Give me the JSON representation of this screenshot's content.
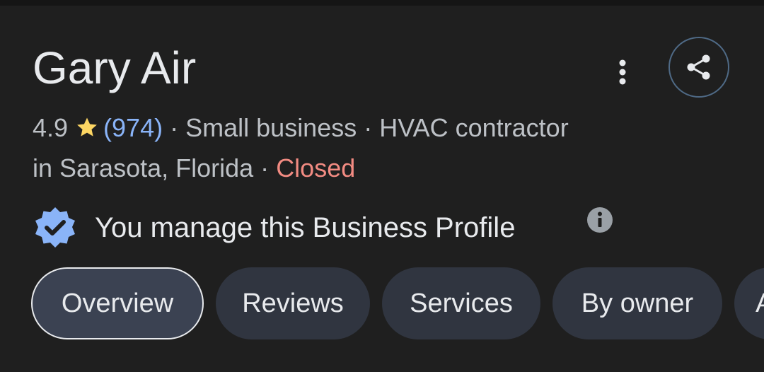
{
  "business": {
    "name": "Gary Air",
    "rating": "4.9",
    "review_count": "(974)",
    "separator": "·",
    "category_1": "Small business",
    "category_2": "HVAC contractor",
    "location": "in Sarasota, Florida",
    "status": "Closed"
  },
  "profile": {
    "manage_text": "You manage this Business Profile"
  },
  "tabs": [
    {
      "label": "Overview",
      "active": true
    },
    {
      "label": "Reviews",
      "active": false
    },
    {
      "label": "Services",
      "active": false
    },
    {
      "label": "By owner",
      "active": false
    },
    {
      "label": "A",
      "active": false
    }
  ],
  "colors": {
    "background": "#1f1f1f",
    "primary_text": "#e8eaed",
    "secondary_text": "#bdc1c6",
    "link_blue": "#8ab4f8",
    "closed_red": "#f28b82",
    "star_yellow": "#fdd663",
    "verified_blue": "#8ab4f8",
    "chip_bg": "#303540"
  },
  "icons": {
    "star": "star-icon",
    "more": "more-vert-icon",
    "share": "share-icon",
    "verified": "verified-badge-icon",
    "info": "info-icon"
  }
}
